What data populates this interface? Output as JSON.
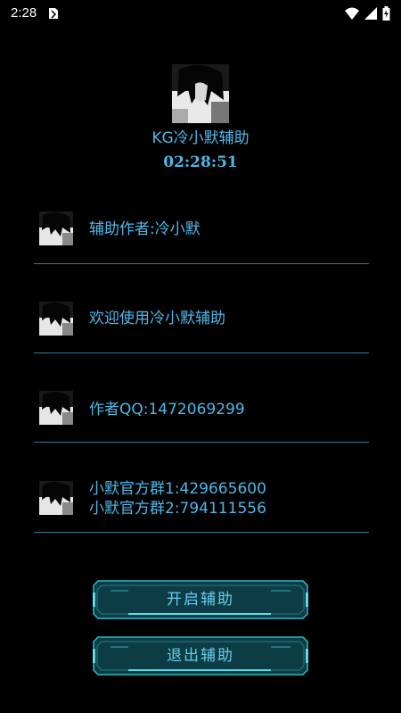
{
  "status_bar": {
    "time": "2:28",
    "icons": [
      "app-notification-icon",
      "wifi-icon",
      "cell-signal-icon",
      "battery-charging-icon"
    ]
  },
  "header": {
    "avatar": "avatar-image",
    "title": "KG冷小默辅助",
    "clock": "02:28:51"
  },
  "info_list": [
    {
      "text": "辅助作者:冷小默"
    },
    {
      "text": "欢迎使用冷小默辅助"
    },
    {
      "text": "作者QQ:1472069299"
    },
    {
      "line1": "小默官方群1:429665600",
      "line2": "小默官方群2:794111556"
    }
  ],
  "buttons": {
    "start": "开启辅助",
    "exit": "退出辅助"
  },
  "colors": {
    "background": "#000000",
    "accent_text": "#4fb7e8",
    "divider": "#2e7a9c",
    "button_fill": "#0c3d45",
    "button_border": "#2fb9c9"
  }
}
